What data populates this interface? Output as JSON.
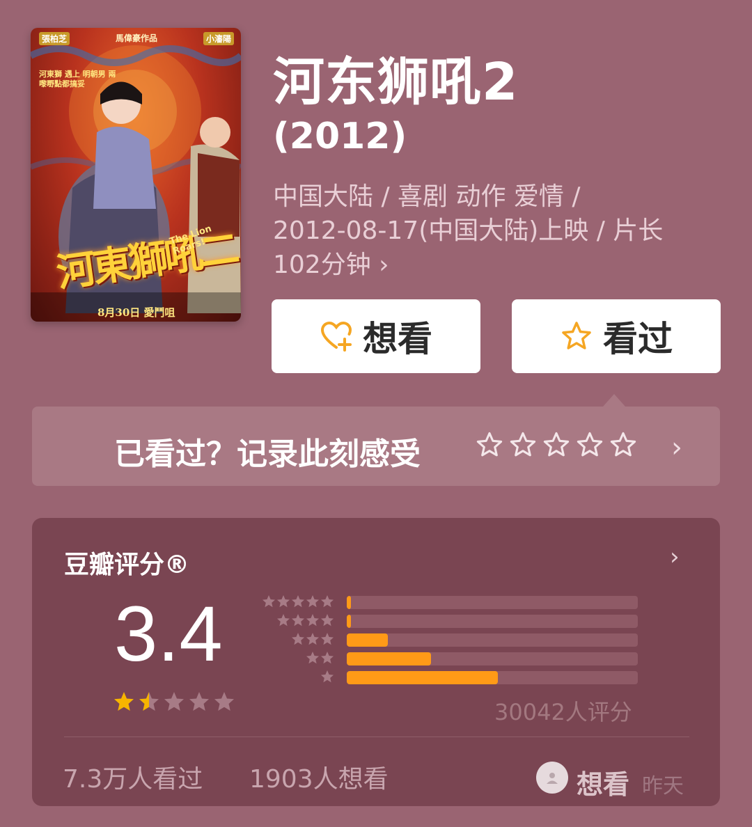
{
  "poster": {
    "cast_left": "張柏芝",
    "director": "馬偉豪作品",
    "cast_right": "小瀋陽",
    "tagline": "河東獅 遇上 明朝男 兩嚟嘢點都搞妥",
    "big_title": "河東獅吼二",
    "english_title": "The Lion Roars!",
    "release": "8月30日 愛鬥咀"
  },
  "movie": {
    "title": "河东狮吼2",
    "year": "(2012)",
    "meta_line1": "中国大陆 / 喜剧 动作 爱情 /",
    "meta_line2": "2012-08-17(中国大陆)上映 / 片长",
    "meta_line3": "102分钟 ›"
  },
  "actions": {
    "want_label": "想看",
    "want_icon": "heart-plus-icon",
    "seen_label": "看过",
    "seen_icon": "star-outline-icon",
    "accent": "#f5a623"
  },
  "record": {
    "prompt": "已看过？记录此刻感受",
    "star_count": 5,
    "chevron": "›"
  },
  "rating": {
    "label": "豆瓣评分®",
    "chevron": "›",
    "score": "3.4",
    "stars_filled": 1.7,
    "distribution": [
      {
        "stars": 5,
        "percent": 1.5
      },
      {
        "stars": 4,
        "percent": 1.5
      },
      {
        "stars": 3,
        "percent": 14
      },
      {
        "stars": 2,
        "percent": 29
      },
      {
        "stars": 1,
        "percent": 52
      }
    ],
    "count_text": "30042人评分",
    "seen_text": "7.3万人看过",
    "want_text": "1903人想看",
    "activity_action": "想看",
    "activity_time": "昨天",
    "bar_color": "#ff9a17",
    "star_color": "#f7b500"
  }
}
